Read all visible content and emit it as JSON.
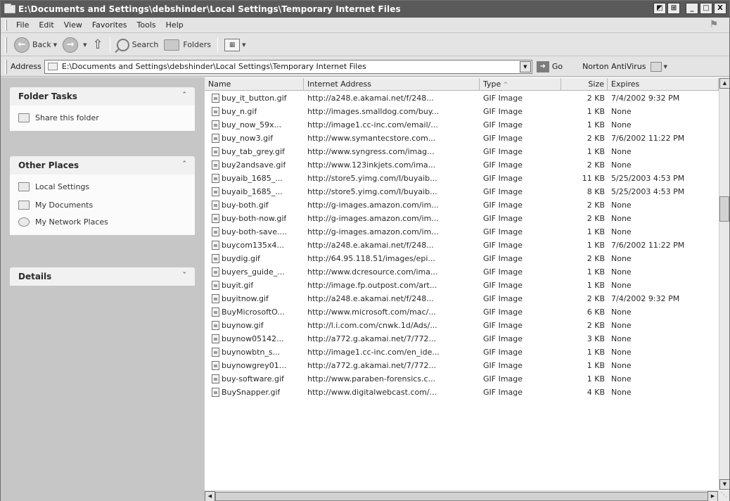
{
  "window": {
    "title": "E:\\Documents and Settings\\debshinder\\Local Settings\\Temporary Internet Files",
    "controls": {
      "minimize": "_",
      "maximize": "□",
      "close": "X",
      "extra1": "◩",
      "extra2": "⊞"
    }
  },
  "menu": {
    "items": [
      "File",
      "Edit",
      "View",
      "Favorites",
      "Tools",
      "Help"
    ]
  },
  "toolbar": {
    "back": "Back",
    "search": "Search",
    "folders": "Folders",
    "views_glyph": "▦"
  },
  "address": {
    "label": "Address",
    "value": "E:\\Documents and Settings\\debshinder\\Local Settings\\Temporary Internet Files",
    "go": "Go",
    "norton": "Norton AntiVirus"
  },
  "left_pane": {
    "folder_tasks": {
      "title": "Folder Tasks",
      "items": [
        "Share this folder"
      ]
    },
    "other_places": {
      "title": "Other Places",
      "items": [
        "Local Settings",
        "My Documents",
        "My Network Places"
      ]
    },
    "details": {
      "title": "Details"
    }
  },
  "columns": {
    "name": "Name",
    "address": "Internet Address",
    "type": "Type",
    "size": "Size",
    "expires": "Expires"
  },
  "files": [
    [
      "buy_it_button.gif",
      "http://a248.e.akamai.net/f/248...",
      "GIF Image",
      "2 KB",
      "7/4/2002 9:32 PM"
    ],
    [
      "buy_n.gif",
      "http://images.smalldog.com/buy...",
      "GIF Image",
      "1 KB",
      "None"
    ],
    [
      "buy_now_59x...",
      "http://image1.cc-inc.com/email/...",
      "GIF Image",
      "1 KB",
      "None"
    ],
    [
      "buy_now3.gif",
      "http://www.symantecstore.com...",
      "GIF Image",
      "2 KB",
      "7/6/2002 11:22 PM"
    ],
    [
      "buy_tab_grey.gif",
      "http://www.syngress.com/imag...",
      "GIF Image",
      "1 KB",
      "None"
    ],
    [
      "buy2andsave.gif",
      "http://www.123inkjets.com/ima...",
      "GIF Image",
      "2 KB",
      "None"
    ],
    [
      "buyaib_1685_...",
      "http://store5.yimg.com/I/buyaib...",
      "GIF Image",
      "11 KB",
      "5/25/2003 4:53 PM"
    ],
    [
      "buyaib_1685_...",
      "http://store5.yimg.com/I/buyaib...",
      "GIF Image",
      "8 KB",
      "5/25/2003 4:53 PM"
    ],
    [
      "buy-both.gif",
      "http://g-images.amazon.com/im...",
      "GIF Image",
      "2 KB",
      "None"
    ],
    [
      "buy-both-now.gif",
      "http://g-images.amazon.com/im...",
      "GIF Image",
      "2 KB",
      "None"
    ],
    [
      "buy-both-save....",
      "http://g-images.amazon.com/im...",
      "GIF Image",
      "1 KB",
      "None"
    ],
    [
      "buycom135x4...",
      "http://a248.e.akamai.net/f/248...",
      "GIF Image",
      "1 KB",
      "7/6/2002 11:22 PM"
    ],
    [
      "buydig.gif",
      "http://64.95.118.51/images/epi...",
      "GIF Image",
      "2 KB",
      "None"
    ],
    [
      "buyers_guide_...",
      "http://www.dcresource.com/ima...",
      "GIF Image",
      "1 KB",
      "None"
    ],
    [
      "buyit.gif",
      "http://image.fp.outpost.com/art...",
      "GIF Image",
      "1 KB",
      "None"
    ],
    [
      "buyitnow.gif",
      "http://a248.e.akamai.net/f/248...",
      "GIF Image",
      "2 KB",
      "7/4/2002 9:32 PM"
    ],
    [
      "BuyMicrosoftO...",
      "http://www.microsoft.com/mac/...",
      "GIF Image",
      "6 KB",
      "None"
    ],
    [
      "buynow.gif",
      "http://l.i.com.com/cnwk.1d/Ads/...",
      "GIF Image",
      "2 KB",
      "None"
    ],
    [
      "buynow05142...",
      "http://a772.g.akamai.net/7/772...",
      "GIF Image",
      "3 KB",
      "None"
    ],
    [
      "buynowbtn_s...",
      "http://image1.cc-inc.com/en_ide...",
      "GIF Image",
      "1 KB",
      "None"
    ],
    [
      "buynowgrey01...",
      "http://a772.g.akamai.net/7/772...",
      "GIF Image",
      "1 KB",
      "None"
    ],
    [
      "buy-software.gif",
      "http://www.paraben-forensics.c...",
      "GIF Image",
      "1 KB",
      "None"
    ],
    [
      "BuySnapper.gif",
      "http://www.digitalwebcast.com/...",
      "GIF Image",
      "4 KB",
      "None"
    ]
  ]
}
